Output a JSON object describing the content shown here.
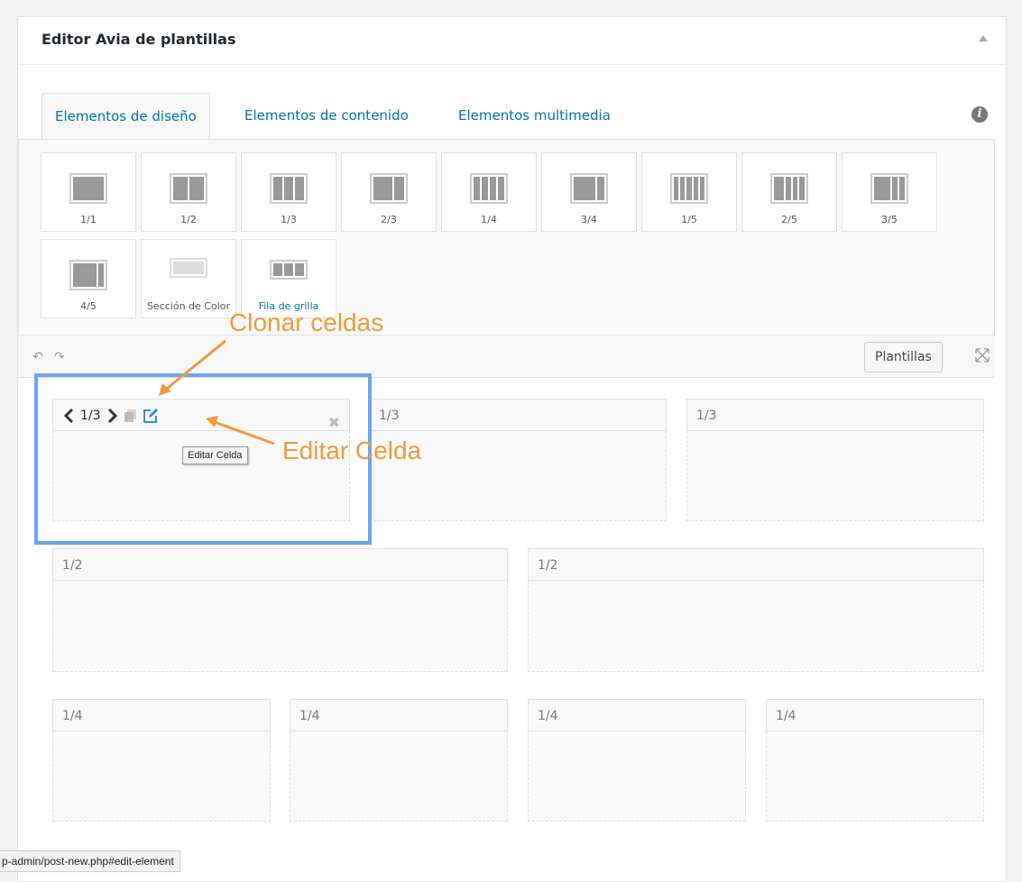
{
  "metabox": {
    "title": "Editor Avia de plantillas"
  },
  "tabs": [
    {
      "label": "Elementos de diseño",
      "active": true
    },
    {
      "label": "Elementos de contenido",
      "active": false
    },
    {
      "label": "Elementos multimedia",
      "active": false
    }
  ],
  "layout_elements": [
    {
      "label": "1/1",
      "icon": "column-1-1-icon"
    },
    {
      "label": "1/2",
      "icon": "column-1-2-icon"
    },
    {
      "label": "1/3",
      "icon": "column-1-3-icon"
    },
    {
      "label": "2/3",
      "icon": "column-2-3-icon"
    },
    {
      "label": "1/4",
      "icon": "column-1-4-icon"
    },
    {
      "label": "3/4",
      "icon": "column-3-4-icon"
    },
    {
      "label": "1/5",
      "icon": "column-1-5-icon"
    },
    {
      "label": "2/5",
      "icon": "column-2-5-icon"
    },
    {
      "label": "3/5",
      "icon": "column-3-5-icon"
    },
    {
      "label": "4/5",
      "icon": "column-4-5-icon"
    },
    {
      "label": "Sección de Color",
      "icon": "color-section-icon"
    },
    {
      "label": "Fila de grilla",
      "icon": "grid-row-icon"
    }
  ],
  "toolbar": {
    "templates_label": "Plantillas"
  },
  "cells": [
    {
      "label": "1/3"
    },
    {
      "label": "1/3"
    },
    {
      "label": "1/3"
    },
    {
      "label": "1/2"
    },
    {
      "label": "1/2"
    },
    {
      "label": "1/4"
    },
    {
      "label": "1/4"
    },
    {
      "label": "1/4"
    },
    {
      "label": "1/4"
    }
  ],
  "tooltip": "Editar Celda",
  "annotations": {
    "clone": "Clonar celdas",
    "edit": "Editar Celda"
  },
  "status_url": "p-admin/post-new.php#edit-element",
  "colors": {
    "accent": "#0073aa",
    "highlight": "#6aa6f0",
    "annotation": "#f19a3a"
  }
}
